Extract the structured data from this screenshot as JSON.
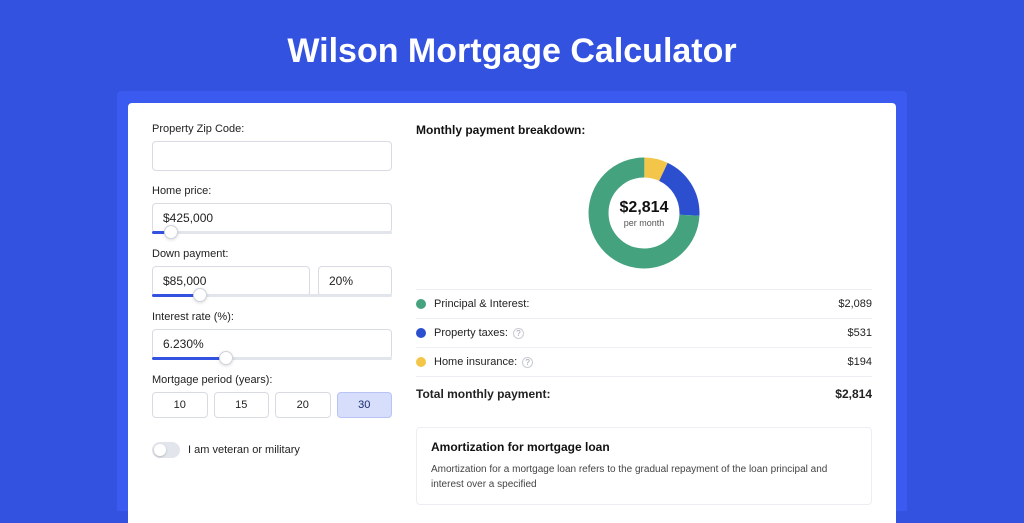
{
  "page_title": "Wilson Mortgage Calculator",
  "colors": {
    "accent": "#3352e0",
    "green": "#44a27f",
    "blue": "#2c4fd0",
    "yellow": "#f3c64a"
  },
  "form": {
    "zip": {
      "label": "Property Zip Code:",
      "value": ""
    },
    "home_price": {
      "label": "Home price:",
      "value": "$425,000",
      "slider_pct": 8
    },
    "down_payment": {
      "label": "Down payment:",
      "amount": "$85,000",
      "percent": "20%",
      "slider_pct": 20
    },
    "interest_rate": {
      "label": "Interest rate (%):",
      "value": "6.230%",
      "slider_pct": 31
    },
    "period": {
      "label": "Mortgage period (years):",
      "options": [
        "10",
        "15",
        "20",
        "30"
      ],
      "selected": "30"
    },
    "veteran_label": "I am veteran or military"
  },
  "breakdown": {
    "header": "Monthly payment breakdown:",
    "center_amount": "$2,814",
    "center_sub": "per month",
    "rows": [
      {
        "label": "Principal & Interest:",
        "value": "$2,089",
        "color": "#44a27f",
        "info": false
      },
      {
        "label": "Property taxes:",
        "value": "$531",
        "color": "#2c4fd0",
        "info": true
      },
      {
        "label": "Home insurance:",
        "value": "$194",
        "color": "#f3c64a",
        "info": true
      }
    ],
    "total_label": "Total monthly payment:",
    "total_value": "$2,814"
  },
  "chart_data": {
    "type": "pie",
    "title": "Monthly payment breakdown",
    "categories": [
      "Principal & Interest",
      "Property taxes",
      "Home insurance"
    ],
    "values": [
      2089,
      531,
      194
    ],
    "colors": [
      "#44a27f",
      "#2c4fd0",
      "#f3c64a"
    ],
    "total": 2814
  },
  "amortization": {
    "title": "Amortization for mortgage loan",
    "text": "Amortization for a mortgage loan refers to the gradual repayment of the loan principal and interest over a specified"
  }
}
